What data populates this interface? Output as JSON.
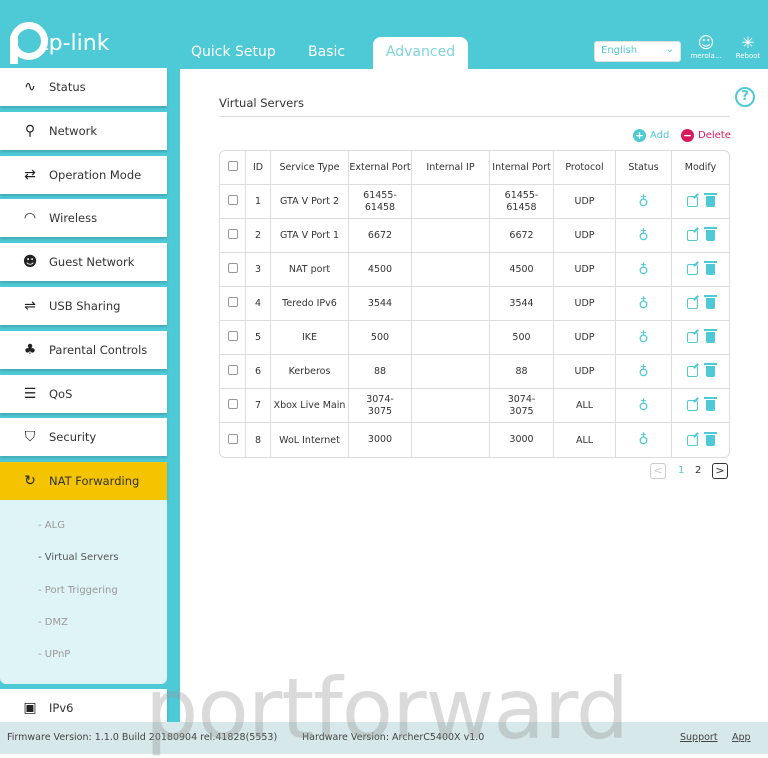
{
  "header": {
    "logo": "tp-link",
    "tabs": [
      "Quick Setup",
      "Basic",
      "Advanced"
    ],
    "active_tab": "Advanced",
    "language": "English",
    "user_label": "merola...",
    "reboot_label": "Reboot"
  },
  "sidebar": {
    "items": [
      {
        "label": "Status",
        "icon": "pulse-icon"
      },
      {
        "label": "Network",
        "icon": "network-icon"
      },
      {
        "label": "Operation Mode",
        "icon": "swap-icon"
      },
      {
        "label": "Wireless",
        "icon": "wifi-icon"
      },
      {
        "label": "Guest Network",
        "icon": "users-icon"
      },
      {
        "label": "USB Sharing",
        "icon": "usb-icon"
      },
      {
        "label": "Parental Controls",
        "icon": "family-icon"
      },
      {
        "label": "QoS",
        "icon": "qos-icon"
      },
      {
        "label": "Security",
        "icon": "shield-icon"
      },
      {
        "label": "NAT Forwarding",
        "icon": "nat-icon"
      }
    ],
    "active": "NAT Forwarding",
    "sub_items": [
      "- ALG",
      "- Virtual Servers",
      "- Port Triggering",
      "- DMZ",
      "- UPnP"
    ],
    "active_sub": "- Virtual Servers",
    "ipv6": "IPv6"
  },
  "main": {
    "title": "Virtual Servers",
    "add_label": "Add",
    "delete_label": "Delete",
    "colors": {
      "accent": "#4ec9d6",
      "delete": "#d6195e",
      "active_nav": "#f5c400"
    },
    "columns": [
      "ID",
      "Service Type",
      "External Port",
      "Internal IP",
      "Internal Port",
      "Protocol",
      "Status",
      "Modify"
    ],
    "rows": [
      {
        "id": "1",
        "service": "GTA V Port 2",
        "ext": "61455-61458",
        "ip": "",
        "int": "61455-61458",
        "proto": "UDP"
      },
      {
        "id": "2",
        "service": "GTA V Port 1",
        "ext": "6672",
        "ip": "",
        "int": "6672",
        "proto": "UDP"
      },
      {
        "id": "3",
        "service": "NAT port",
        "ext": "4500",
        "ip": "",
        "int": "4500",
        "proto": "UDP"
      },
      {
        "id": "4",
        "service": "Teredo IPv6",
        "ext": "3544",
        "ip": "",
        "int": "3544",
        "proto": "UDP"
      },
      {
        "id": "5",
        "service": "IKE",
        "ext": "500",
        "ip": "",
        "int": "500",
        "proto": "UDP"
      },
      {
        "id": "6",
        "service": "Kerberos",
        "ext": "88",
        "ip": "",
        "int": "88",
        "proto": "UDP"
      },
      {
        "id": "7",
        "service": "Xbox Live Main",
        "ext": "3074-3075",
        "ip": "",
        "int": "3074-3075",
        "proto": "ALL"
      },
      {
        "id": "8",
        "service": "WoL Internet",
        "ext": "3000",
        "ip": "",
        "int": "3000",
        "proto": "ALL"
      }
    ],
    "pagination": {
      "pages": [
        "1",
        "2"
      ],
      "current": "2",
      "prev": "<",
      "next": ">"
    }
  },
  "footer": {
    "firmware": "Firmware Version: 1.1.0 Build 20180904 rel.41828(5553)",
    "hardware": "Hardware Version: ArcherC5400X v1.0",
    "support": "Support",
    "app": "App"
  },
  "watermark": "portforward"
}
